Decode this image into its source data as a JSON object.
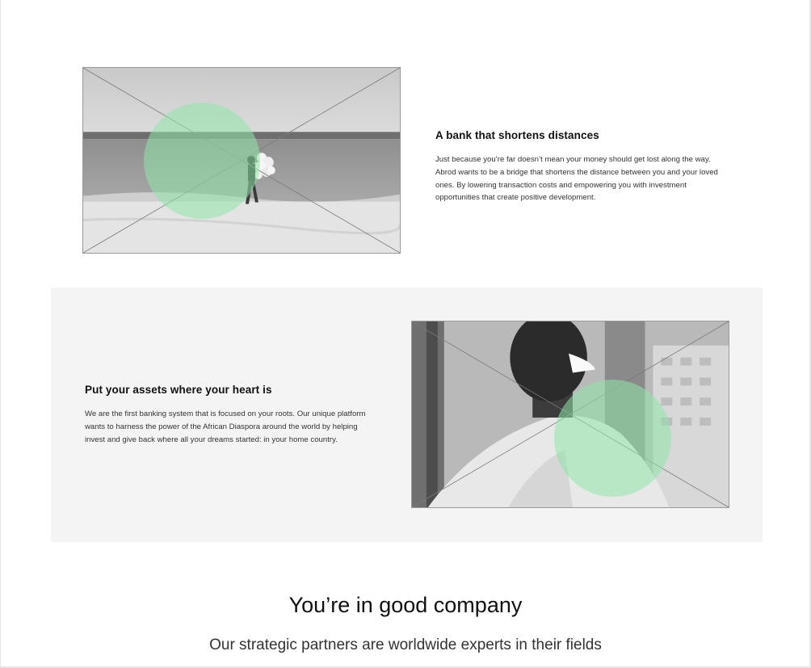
{
  "features": [
    {
      "title": "A bank that shortens distances",
      "body": "Just because you’re far doesn’t mean your money should get lost along the way. Abrod wants to be a bridge that shortens the distance between you and your loved ones. By lowering transaction costs and empowering you with investment opportunities that create positive development.",
      "image": "man walking on beach carrying balloons"
    },
    {
      "title": "Put your assets where your heart is",
      "body": "We are the first banking system that is focused on your roots. Our unique platform wants to harness the power of the African Diaspora around the world by helping invest and give back where all your dreams started: in your home country.",
      "image": "smiling man outdoors"
    }
  ],
  "company": {
    "title": "You’re in good company",
    "subtitle": "Our strategic partners are worldwide experts in their fields"
  },
  "colors": {
    "accent_circle": "#90e6aa",
    "band_background": "#f4f4f4",
    "heading": "#111111",
    "body_text": "#333333"
  }
}
